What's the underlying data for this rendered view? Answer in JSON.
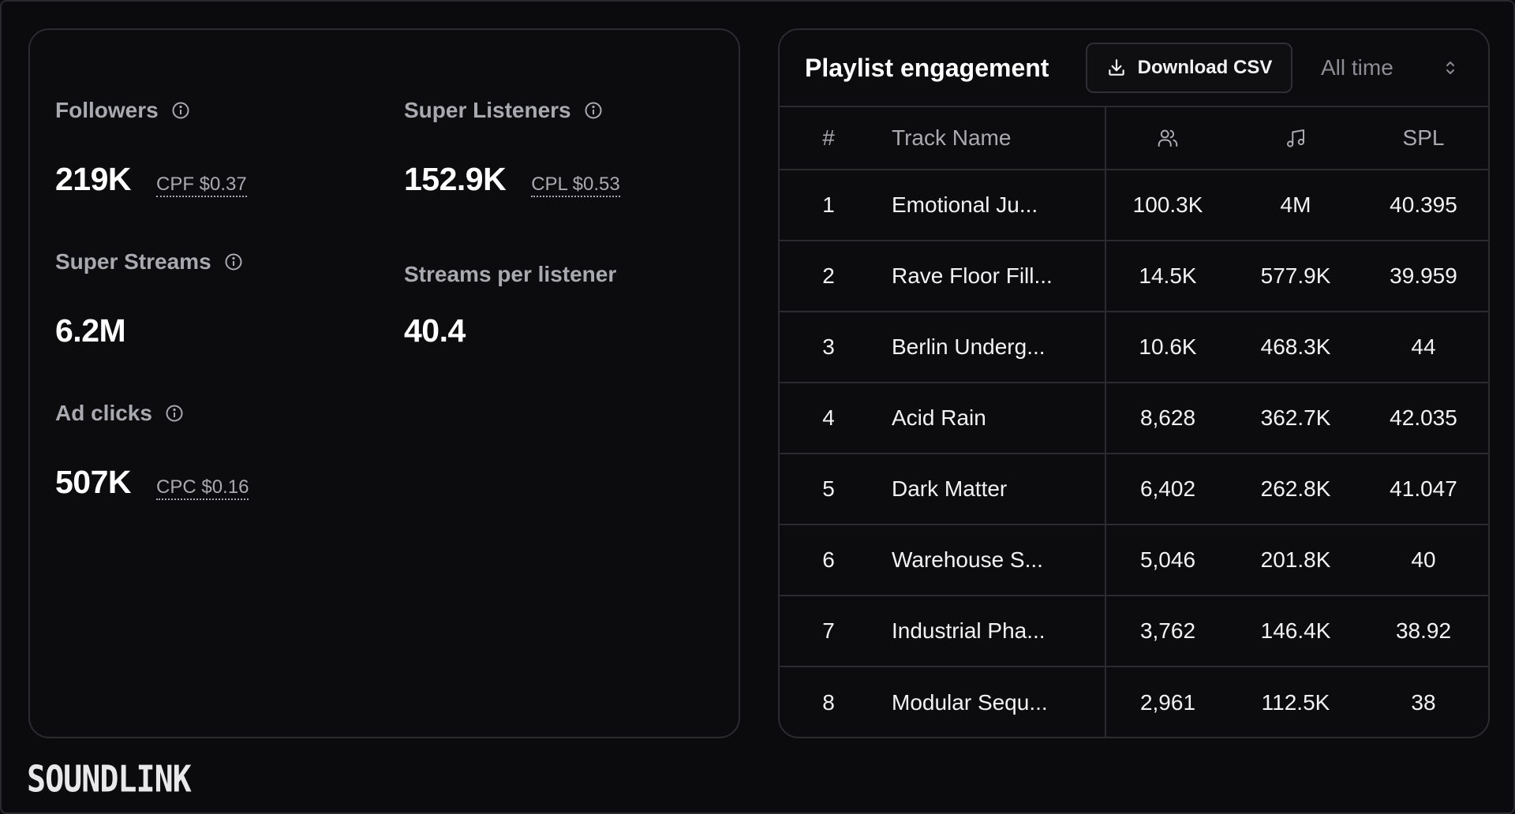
{
  "stats": {
    "followers": {
      "label": "Followers",
      "value": "219K",
      "cost": "CPF $0.37"
    },
    "super_listeners": {
      "label": "Super Listeners",
      "value": "152.9K",
      "cost": "CPL $0.53"
    },
    "super_streams": {
      "label": "Super Streams",
      "value": "6.2M"
    },
    "streams_per_listener": {
      "label": "Streams per listener",
      "value": "40.4"
    },
    "ad_clicks": {
      "label": "Ad clicks",
      "value": "507K",
      "cost": "CPC $0.16"
    }
  },
  "table": {
    "title": "Playlist engagement",
    "download_label": "Download CSV",
    "range_value": "All time",
    "headers": {
      "num": "#",
      "name": "Track Name",
      "listeners_icon": "users-icon",
      "streams_icon": "music-note-icon",
      "spl": "SPL"
    },
    "rows": [
      {
        "num": "1",
        "name": "Emotional Ju...",
        "listeners": "100.3K",
        "streams": "4M",
        "spl": "40.395"
      },
      {
        "num": "2",
        "name": "Rave Floor Fill...",
        "listeners": "14.5K",
        "streams": "577.9K",
        "spl": "39.959"
      },
      {
        "num": "3",
        "name": "Berlin Underg...",
        "listeners": "10.6K",
        "streams": "468.3K",
        "spl": "44"
      },
      {
        "num": "4",
        "name": "Acid Rain",
        "listeners": "8,628",
        "streams": "362.7K",
        "spl": "42.035"
      },
      {
        "num": "5",
        "name": "Dark Matter",
        "listeners": "6,402",
        "streams": "262.8K",
        "spl": "41.047"
      },
      {
        "num": "6",
        "name": "Warehouse S...",
        "listeners": "5,046",
        "streams": "201.8K",
        "spl": "40"
      },
      {
        "num": "7",
        "name": "Industrial Pha...",
        "listeners": "3,762",
        "streams": "146.4K",
        "spl": "38.92"
      },
      {
        "num": "8",
        "name": "Modular Sequ...",
        "listeners": "2,961",
        "streams": "112.5K",
        "spl": "38"
      }
    ]
  },
  "brand": {
    "logo_text": "SOUNDLINK"
  },
  "colors": {
    "background": "#0b0b0d",
    "card_border": "#2b2b30",
    "muted_text": "#a9a9b0",
    "primary_text": "#ffffff"
  }
}
